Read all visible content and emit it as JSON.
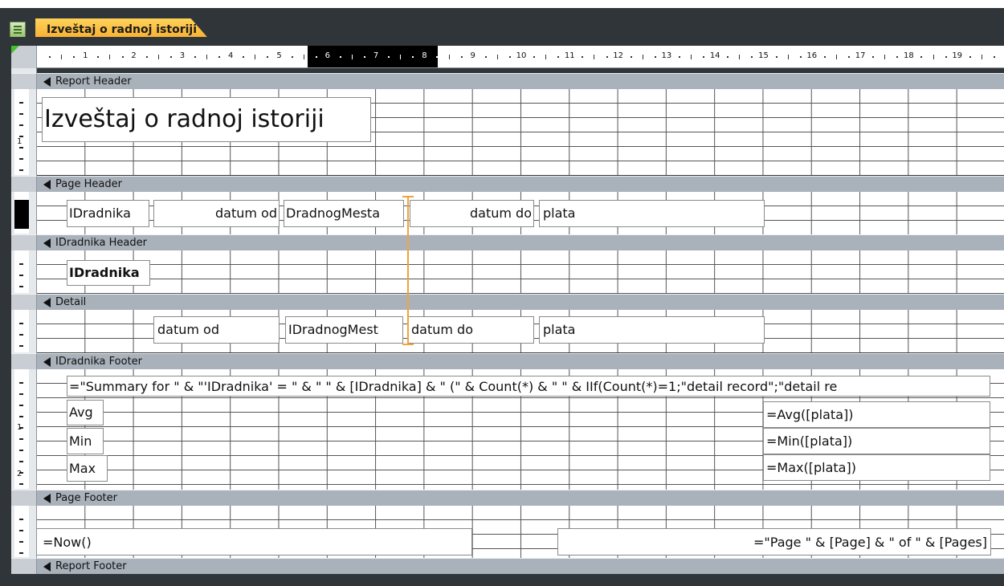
{
  "app": {
    "document_tab": "Izveštaj o radnoj istoriji"
  },
  "ruler": {
    "labels": [
      "1",
      "2",
      "3",
      "4",
      "5",
      "6",
      "7",
      "8",
      "9",
      "10",
      "11",
      "12",
      "13",
      "14",
      "15",
      "16",
      "17",
      "18",
      "19"
    ]
  },
  "vertical_ruler": {
    "labels": [
      "1",
      "1",
      "2"
    ]
  },
  "sections": {
    "report_header": {
      "band_label": "Report Header",
      "title_control": "Izveštaj o radnoj istoriji"
    },
    "page_header": {
      "band_label": "Page Header",
      "controls": [
        "IDradnika",
        "datum od",
        "DradnogMesta",
        "datum do",
        "plata"
      ]
    },
    "group_header": {
      "band_label": "IDradnika Header",
      "controls": [
        "IDradnika"
      ]
    },
    "detail": {
      "band_label": "Detail",
      "controls": [
        "datum od",
        "IDradnogMest",
        "datum do",
        "plata"
      ]
    },
    "group_footer": {
      "band_label": "IDradnika Footer",
      "summary_expression": "=\"Summary for \" & \"'IDradnika' = \" & \" \" & [IDradnika] & \" (\" & Count(*) & \" \" & IIf(Count(*)=1;\"detail record\";\"detail re",
      "labels": [
        "Avg",
        "Min",
        "Max"
      ],
      "expressions": [
        "=Avg([plata])",
        "=Min([plata])",
        "=Max([plata])"
      ]
    },
    "page_footer": {
      "band_label": "Page Footer",
      "now_expression": "=Now()",
      "page_expression": "=\"Page \" & [Page] & \" of \" & [Pages]"
    },
    "report_footer": {
      "band_label": "Report Footer"
    }
  },
  "colors": {
    "tab_active": "#f6a829",
    "dark_frame": "#303539",
    "band_bar": "#a9b1ba",
    "resize_guide": "#f0a33a"
  }
}
